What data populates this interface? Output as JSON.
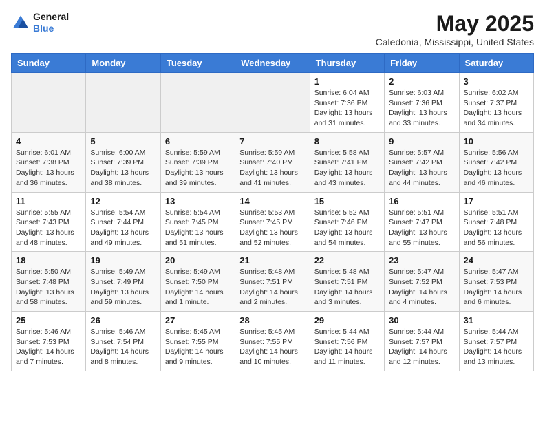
{
  "header": {
    "logo_general": "General",
    "logo_blue": "Blue",
    "month_year": "May 2025",
    "location": "Caledonia, Mississippi, United States"
  },
  "weekdays": [
    "Sunday",
    "Monday",
    "Tuesday",
    "Wednesday",
    "Thursday",
    "Friday",
    "Saturday"
  ],
  "weeks": [
    [
      {
        "day": "",
        "info": ""
      },
      {
        "day": "",
        "info": ""
      },
      {
        "day": "",
        "info": ""
      },
      {
        "day": "",
        "info": ""
      },
      {
        "day": "1",
        "info": "Sunrise: 6:04 AM\nSunset: 7:36 PM\nDaylight: 13 hours\nand 31 minutes."
      },
      {
        "day": "2",
        "info": "Sunrise: 6:03 AM\nSunset: 7:36 PM\nDaylight: 13 hours\nand 33 minutes."
      },
      {
        "day": "3",
        "info": "Sunrise: 6:02 AM\nSunset: 7:37 PM\nDaylight: 13 hours\nand 34 minutes."
      }
    ],
    [
      {
        "day": "4",
        "info": "Sunrise: 6:01 AM\nSunset: 7:38 PM\nDaylight: 13 hours\nand 36 minutes."
      },
      {
        "day": "5",
        "info": "Sunrise: 6:00 AM\nSunset: 7:39 PM\nDaylight: 13 hours\nand 38 minutes."
      },
      {
        "day": "6",
        "info": "Sunrise: 5:59 AM\nSunset: 7:39 PM\nDaylight: 13 hours\nand 39 minutes."
      },
      {
        "day": "7",
        "info": "Sunrise: 5:59 AM\nSunset: 7:40 PM\nDaylight: 13 hours\nand 41 minutes."
      },
      {
        "day": "8",
        "info": "Sunrise: 5:58 AM\nSunset: 7:41 PM\nDaylight: 13 hours\nand 43 minutes."
      },
      {
        "day": "9",
        "info": "Sunrise: 5:57 AM\nSunset: 7:42 PM\nDaylight: 13 hours\nand 44 minutes."
      },
      {
        "day": "10",
        "info": "Sunrise: 5:56 AM\nSunset: 7:42 PM\nDaylight: 13 hours\nand 46 minutes."
      }
    ],
    [
      {
        "day": "11",
        "info": "Sunrise: 5:55 AM\nSunset: 7:43 PM\nDaylight: 13 hours\nand 48 minutes."
      },
      {
        "day": "12",
        "info": "Sunrise: 5:54 AM\nSunset: 7:44 PM\nDaylight: 13 hours\nand 49 minutes."
      },
      {
        "day": "13",
        "info": "Sunrise: 5:54 AM\nSunset: 7:45 PM\nDaylight: 13 hours\nand 51 minutes."
      },
      {
        "day": "14",
        "info": "Sunrise: 5:53 AM\nSunset: 7:45 PM\nDaylight: 13 hours\nand 52 minutes."
      },
      {
        "day": "15",
        "info": "Sunrise: 5:52 AM\nSunset: 7:46 PM\nDaylight: 13 hours\nand 54 minutes."
      },
      {
        "day": "16",
        "info": "Sunrise: 5:51 AM\nSunset: 7:47 PM\nDaylight: 13 hours\nand 55 minutes."
      },
      {
        "day": "17",
        "info": "Sunrise: 5:51 AM\nSunset: 7:48 PM\nDaylight: 13 hours\nand 56 minutes."
      }
    ],
    [
      {
        "day": "18",
        "info": "Sunrise: 5:50 AM\nSunset: 7:48 PM\nDaylight: 13 hours\nand 58 minutes."
      },
      {
        "day": "19",
        "info": "Sunrise: 5:49 AM\nSunset: 7:49 PM\nDaylight: 13 hours\nand 59 minutes."
      },
      {
        "day": "20",
        "info": "Sunrise: 5:49 AM\nSunset: 7:50 PM\nDaylight: 14 hours\nand 1 minute."
      },
      {
        "day": "21",
        "info": "Sunrise: 5:48 AM\nSunset: 7:51 PM\nDaylight: 14 hours\nand 2 minutes."
      },
      {
        "day": "22",
        "info": "Sunrise: 5:48 AM\nSunset: 7:51 PM\nDaylight: 14 hours\nand 3 minutes."
      },
      {
        "day": "23",
        "info": "Sunrise: 5:47 AM\nSunset: 7:52 PM\nDaylight: 14 hours\nand 4 minutes."
      },
      {
        "day": "24",
        "info": "Sunrise: 5:47 AM\nSunset: 7:53 PM\nDaylight: 14 hours\nand 6 minutes."
      }
    ],
    [
      {
        "day": "25",
        "info": "Sunrise: 5:46 AM\nSunset: 7:53 PM\nDaylight: 14 hours\nand 7 minutes."
      },
      {
        "day": "26",
        "info": "Sunrise: 5:46 AM\nSunset: 7:54 PM\nDaylight: 14 hours\nand 8 minutes."
      },
      {
        "day": "27",
        "info": "Sunrise: 5:45 AM\nSunset: 7:55 PM\nDaylight: 14 hours\nand 9 minutes."
      },
      {
        "day": "28",
        "info": "Sunrise: 5:45 AM\nSunset: 7:55 PM\nDaylight: 14 hours\nand 10 minutes."
      },
      {
        "day": "29",
        "info": "Sunrise: 5:44 AM\nSunset: 7:56 PM\nDaylight: 14 hours\nand 11 minutes."
      },
      {
        "day": "30",
        "info": "Sunrise: 5:44 AM\nSunset: 7:57 PM\nDaylight: 14 hours\nand 12 minutes."
      },
      {
        "day": "31",
        "info": "Sunrise: 5:44 AM\nSunset: 7:57 PM\nDaylight: 14 hours\nand 13 minutes."
      }
    ]
  ]
}
